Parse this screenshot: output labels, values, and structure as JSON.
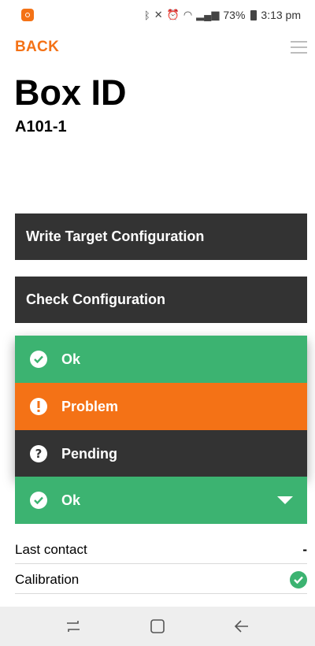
{
  "status_bar": {
    "battery": "73%",
    "time": "3:13 pm",
    "icons": [
      "bluetooth-icon",
      "mute-icon",
      "alarm-icon",
      "wifi-icon",
      "signal-icon",
      "battery-icon"
    ]
  },
  "header": {
    "back_label": "BACK",
    "menu_icon": "hamburger-menu-icon"
  },
  "page": {
    "title": "Box ID",
    "subtitle": "A101-1"
  },
  "actions": {
    "write_label": "Write Target Configuration",
    "check_label": "Check Configuration"
  },
  "status_dropdown": {
    "options": [
      {
        "label": "Ok",
        "icon": "check-circle-icon",
        "color": "#3cb371"
      },
      {
        "label": "Problem",
        "icon": "exclamation-circle-icon",
        "color": "#f47216"
      },
      {
        "label": "Pending",
        "icon": "question-circle-icon",
        "color": "#333333"
      }
    ],
    "selected_label": "Ok",
    "selected_color": "#3cb371"
  },
  "details": {
    "rows": [
      {
        "label": "Last contact",
        "value": "-"
      },
      {
        "label": "Calibration",
        "icon": "check-circle-icon"
      }
    ]
  },
  "nav": {
    "items": [
      "recents-icon",
      "home-icon",
      "back-arrow-icon"
    ]
  },
  "colors": {
    "accent": "#f47216",
    "ok": "#3cb371",
    "dark": "#333333"
  }
}
